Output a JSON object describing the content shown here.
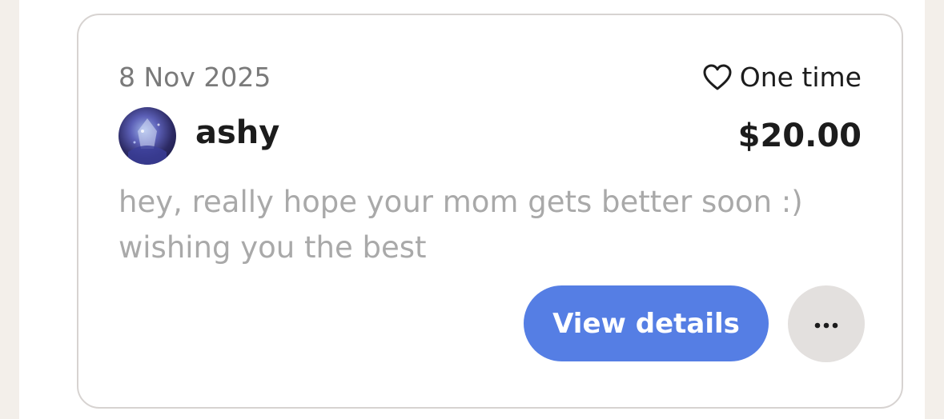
{
  "donation": {
    "date": "8 Nov 2025",
    "frequency": "One time",
    "donor_name": "ashy",
    "amount": "$20.00",
    "message": "hey, really hope your mom gets better soon :) wishing you the best",
    "actions": {
      "view_details_label": "View details"
    }
  },
  "icons": {
    "frequency_icon": "heart-outline-icon",
    "more_icon": "ellipsis-horizontal-icon"
  },
  "colors": {
    "primary_button": "#557ee4",
    "secondary_button": "#e3e0de",
    "muted_text": "#a9a9a9",
    "page_background": "#f3efea"
  }
}
